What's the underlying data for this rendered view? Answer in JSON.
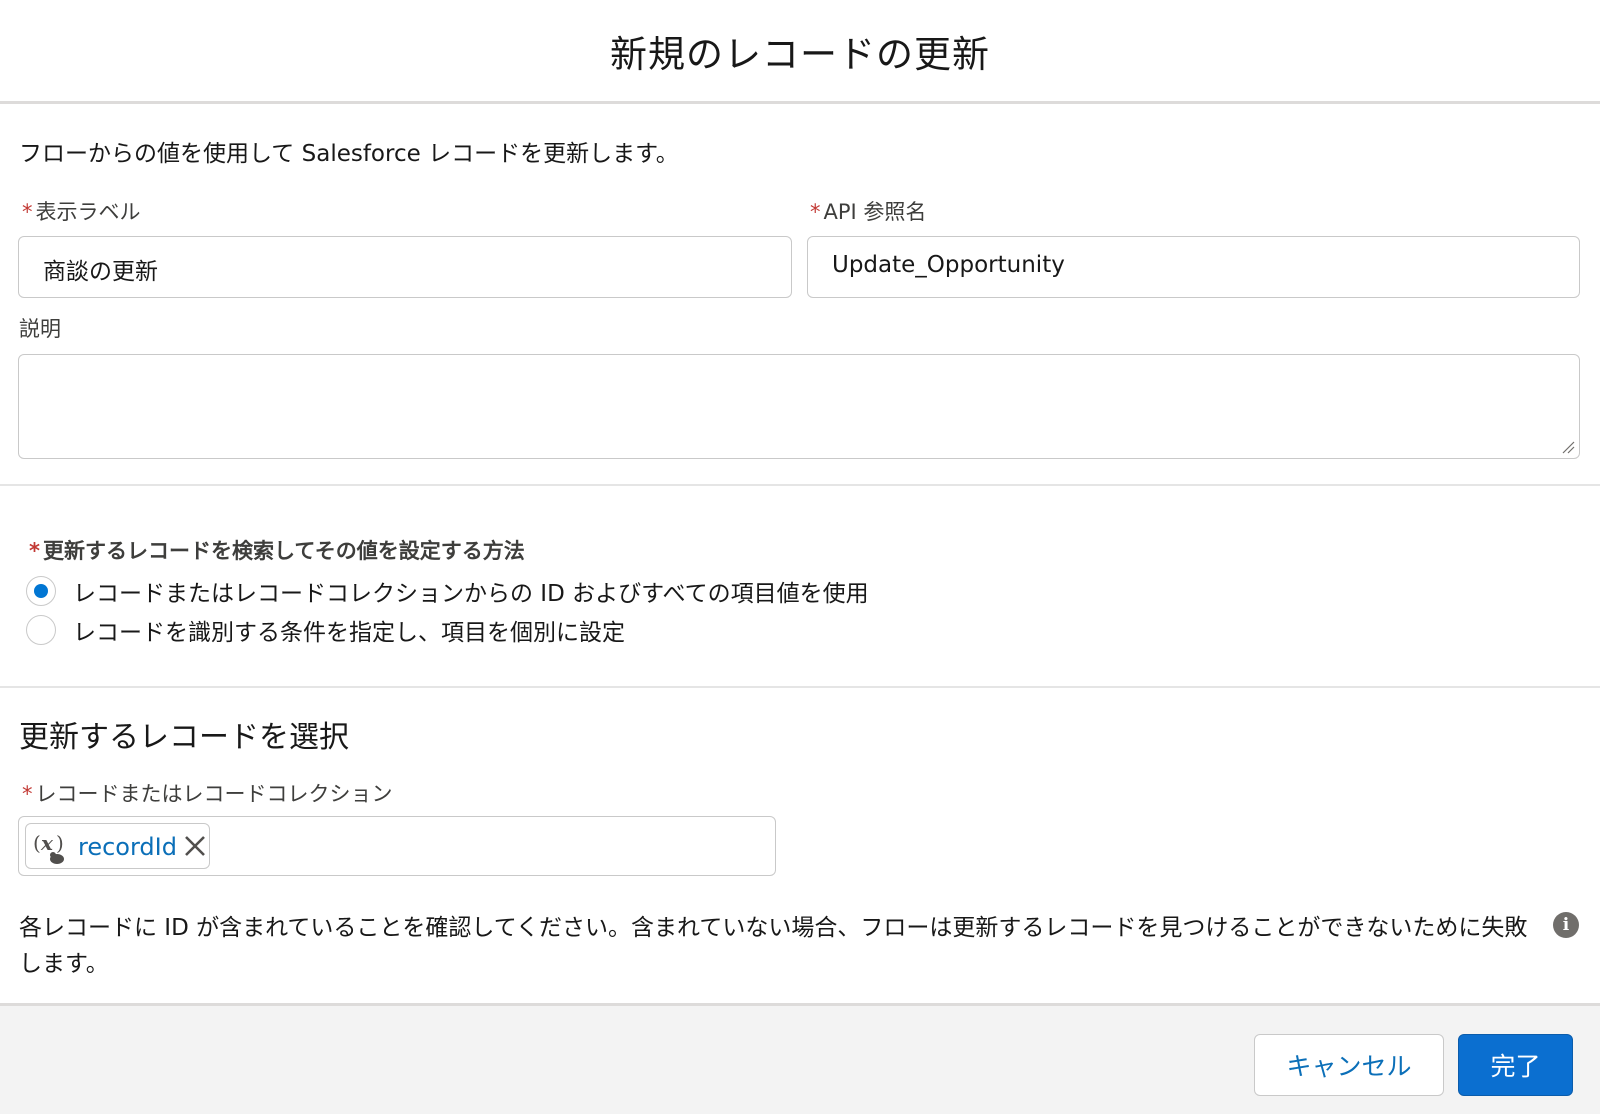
{
  "header": {
    "title": "新規のレコードの更新"
  },
  "description": "フローからの値を使用して Salesforce レコードを更新します。",
  "required_marker": "*",
  "fields": {
    "label": {
      "label": "表示ラベル",
      "value": "商談の更新"
    },
    "api_name": {
      "label": "API 参照名",
      "value": "Update_Opportunity"
    },
    "description": {
      "label": "説明",
      "value": ""
    }
  },
  "method": {
    "label": "更新するレコードを検索してその値を設定する方法",
    "options": [
      {
        "label": "レコードまたはレコードコレクションからの ID およびすべての項目値を使用",
        "selected": true
      },
      {
        "label": "レコードを識別する条件を指定し、項目を個別に設定",
        "selected": false
      }
    ]
  },
  "select_section": {
    "title": "更新するレコードを選択",
    "record_field": {
      "label": "レコードまたはレコードコレクション",
      "pill_value": "recordId",
      "pill_icon": "variable-icon"
    }
  },
  "info": {
    "text": "各レコードに ID が含まれていることを確認してください。含まれていない場合、フローは更新するレコードを見つけることができないために失敗します。",
    "icon_glyph": "i"
  },
  "footer": {
    "cancel_label": "キャンセル",
    "done_label": "完了"
  },
  "colors": {
    "brand": "#0b6fd0",
    "required": "#c23934",
    "link": "#0b6fb8",
    "radio_checked": "#0176d3"
  }
}
